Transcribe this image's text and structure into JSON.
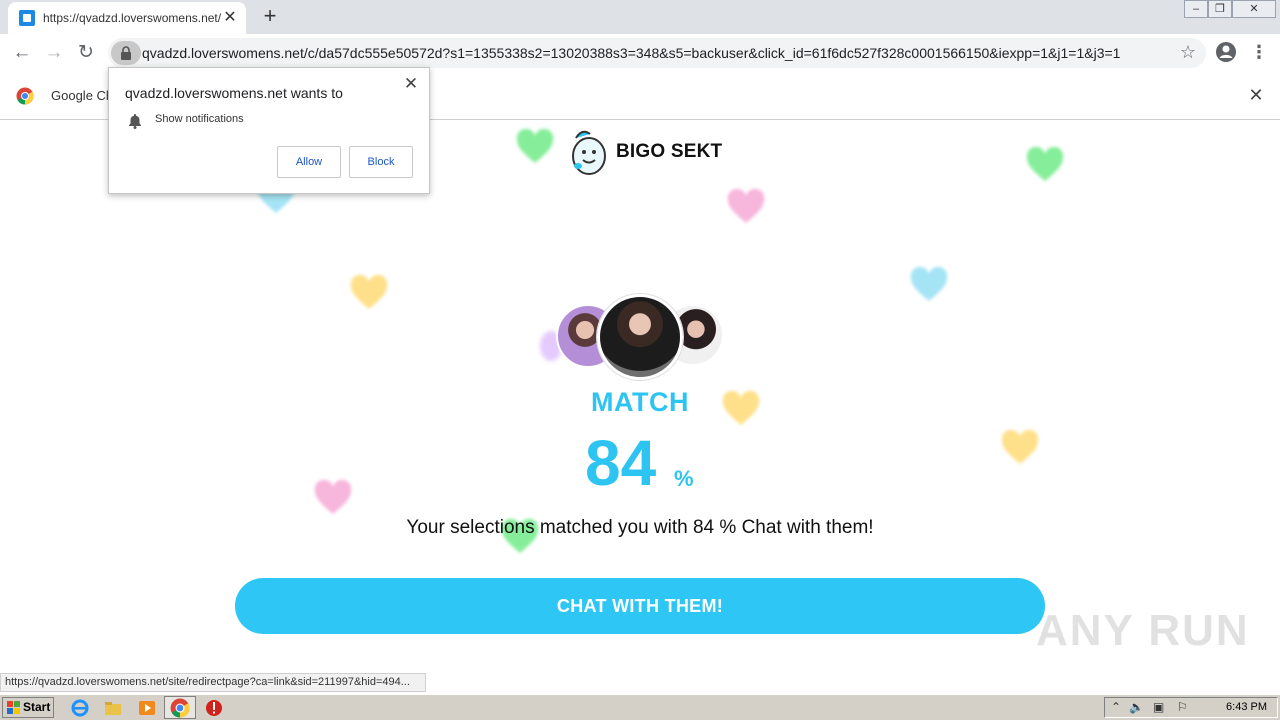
{
  "browser": {
    "tab_title": "https://qvadzd.loverswomens.net/c/",
    "tab_close": "✕",
    "new_tab": "+",
    "url": "qvadzd.loverswomens.net/c/da57dc555e50572d?s1=1355338s2=13020388s3=348&s5=backuser&click_id=61f6dc527f328c0001566150&iexpp=1&j1=1&j3=1",
    "infobar_text": "Google Ch",
    "status_url": "https://qvadzd.loverswomens.net/site/redirectpage?ca=link&sid=211997&hid=494..."
  },
  "notification": {
    "title": "qvadzd.loverswomens.net wants to",
    "permission": "Show notifications",
    "allow_label": "Allow",
    "block_label": "Block"
  },
  "page": {
    "brand": "BIGO SEKT",
    "match_label": "MATCH",
    "match_value": "84",
    "match_pct": "%",
    "subtitle": "Your selections matched you with   84 %  Chat with them!",
    "cta_label": "CHAT WITH THEM!",
    "watermark": "ANY RUN"
  },
  "taskbar": {
    "start_label": "Start",
    "clock": "6:43 PM"
  },
  "colors": {
    "accent": "#2ec4f1",
    "cta": "#2ec7f5"
  }
}
